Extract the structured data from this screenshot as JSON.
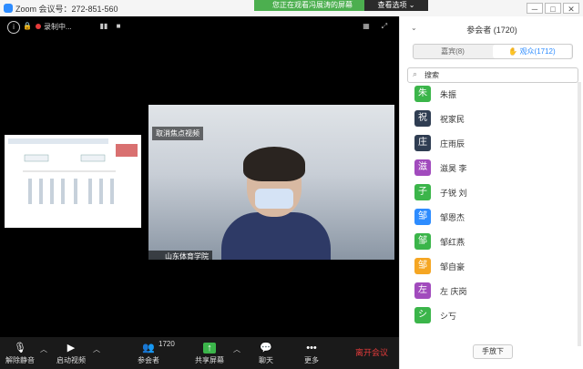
{
  "window": {
    "title": "Zoom 会议号：272-851-560",
    "min": "─",
    "max": "□",
    "close": "✕"
  },
  "share_banner": {
    "text": "您正在观看冯展涛的屏幕",
    "view_options": "查看选项 ⌄"
  },
  "top_controls": {
    "info": "i",
    "lock": "🔒",
    "recording": "录制中...",
    "pause": "▮▮",
    "stop": "■",
    "grid": "▦",
    "fullscreen": "⤢"
  },
  "speaker": {
    "cancel_spotlight": "取消焦点视频",
    "name": "山东体育学院"
  },
  "toolbar": {
    "unmute": "解除静音",
    "start_video": "启动视频",
    "participants": "参会者",
    "participants_count": "1720",
    "share": "共享屏幕",
    "chat": "聊天",
    "more": "更多",
    "leave": "离开会议"
  },
  "panel": {
    "title": "参会者 (1720)",
    "collapse": "⌄",
    "tab_panelists": "嘉宾(8)",
    "tab_attendees": "观众(1712)",
    "search_placeholder": "搜索",
    "raise_hand": "手放下",
    "participants": [
      {
        "initial": "朱",
        "name": "朱振",
        "color": "#3bb54a"
      },
      {
        "initial": "祝",
        "name": "祝家民",
        "color": "#2f3d52"
      },
      {
        "initial": "庄",
        "name": "庄雨辰",
        "color": "#2f3d52"
      },
      {
        "initial": "滋",
        "name": "滋昊 李",
        "color": "#a14bbd"
      },
      {
        "initial": "子",
        "name": "子锐 刘",
        "color": "#3bb54a"
      },
      {
        "initial": "邹",
        "name": "邹恩杰",
        "color": "#2d8cff"
      },
      {
        "initial": "邹",
        "name": "邹红燕",
        "color": "#3bb54a"
      },
      {
        "initial": "邹",
        "name": "邹自豪",
        "color": "#f5a623"
      },
      {
        "initial": "左",
        "name": "左 庆岗",
        "color": "#a14bbd"
      },
      {
        "initial": "シ",
        "name": "シ丂",
        "color": "#3bb54a"
      }
    ]
  }
}
